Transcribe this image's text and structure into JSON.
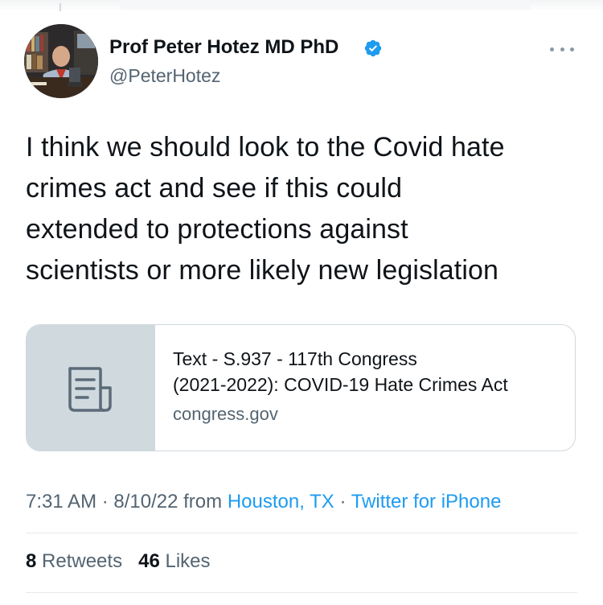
{
  "author": {
    "display_name": "Prof Peter Hotez MD PhD",
    "handle": "@PeterHotez",
    "verified": true,
    "verified_color": "#1d9bf0"
  },
  "tweet": {
    "lines": [
      "I think we should look to the Covid hate",
      "crimes act and see if this could",
      "extended to protections against",
      "scientists or more likely new legislation"
    ]
  },
  "link_card": {
    "icon": "document-icon",
    "title_lines": [
      "Text - S.937 - 117th Congress",
      "(2021-2022): COVID-19 Hate Crimes Act"
    ],
    "domain": "congress.gov"
  },
  "meta": {
    "time": "7:31 AM",
    "sep1": " · ",
    "date": "8/10/22",
    "from_label": " from ",
    "location": "Houston, TX",
    "sep2": " · ",
    "client": "Twitter for iPhone"
  },
  "stats": {
    "retweets_count": "8",
    "retweets_label": "Retweets",
    "likes_count": "46",
    "likes_label": "Likes"
  },
  "colors": {
    "link": "#1d9bf0",
    "secondary_text": "#536471",
    "card_border": "#cfd9de"
  }
}
